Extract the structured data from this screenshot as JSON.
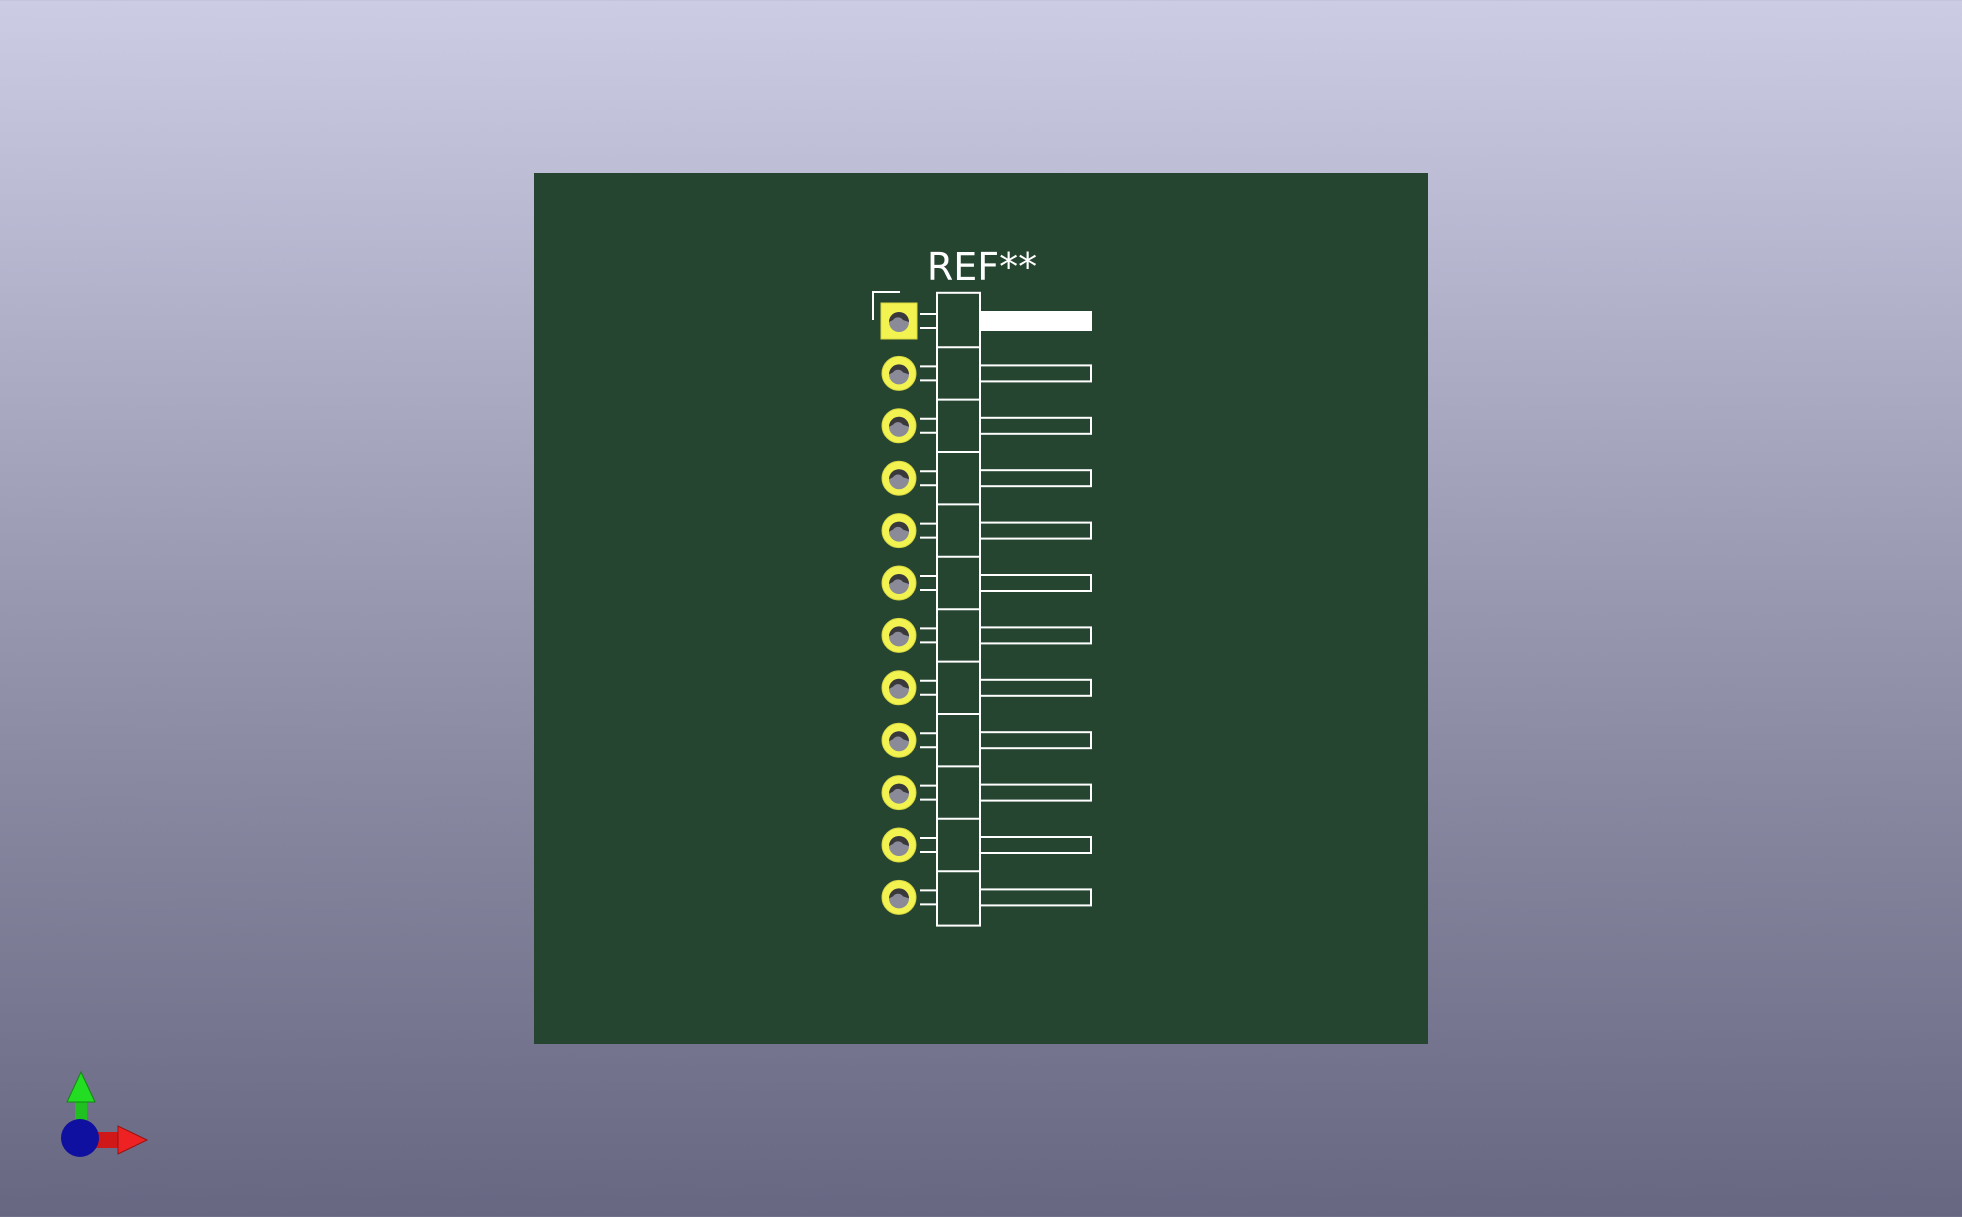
{
  "viewer": {
    "reference_label": "REF**",
    "pin_count": 12,
    "pin1_shape": "square",
    "colors": {
      "board": "#254531",
      "silkscreen": "#ffffff",
      "pad": "#f2f250",
      "pad_ring_dark": "#d8d840",
      "drill": "#8a8a98",
      "axis_x": "#e02020",
      "axis_y": "#20c020",
      "axis_z": "#1010a0"
    },
    "axes": {
      "x_icon": "x-axis-arrow-icon",
      "y_icon": "y-axis-arrow-icon",
      "z_icon": "z-axis-origin-icon"
    }
  }
}
